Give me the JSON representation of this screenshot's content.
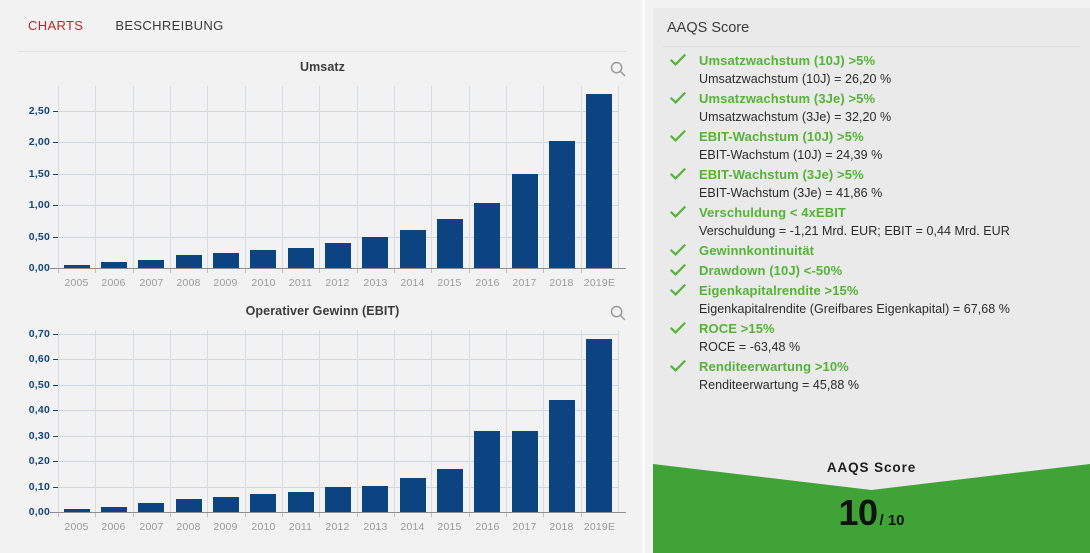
{
  "tabs": [
    {
      "label": "CHARTS",
      "active": true
    },
    {
      "label": "BESCHREIBUNG",
      "active": false
    }
  ],
  "colors": {
    "bar": "#0c4481",
    "accent_green": "#3fa335",
    "criteria_green": "#55b336",
    "tab_active": "#b5272d",
    "axis_label": "#14447c"
  },
  "icons": {
    "search": "search-icon",
    "check": "check-icon"
  },
  "chart_data": [
    {
      "type": "bar",
      "title": "Umsatz",
      "xlabel": "",
      "ylabel": "",
      "categories": [
        "2005",
        "2006",
        "2007",
        "2008",
        "2009",
        "2010",
        "2011",
        "2012",
        "2013",
        "2014",
        "2015",
        "2016",
        "2017",
        "2018",
        "2019E"
      ],
      "values": [
        0.05,
        0.09,
        0.13,
        0.2,
        0.24,
        0.28,
        0.32,
        0.4,
        0.5,
        0.6,
        0.78,
        1.03,
        1.5,
        2.03,
        2.78
      ],
      "yticks": [
        "0,00",
        "0,50",
        "1,00",
        "1,50",
        "2,00",
        "2,50"
      ],
      "ytick_values": [
        0,
        0.5,
        1.0,
        1.5,
        2.0,
        2.5
      ],
      "ylim": [
        0,
        2.9
      ],
      "grid": true,
      "legend": "none"
    },
    {
      "type": "bar",
      "title": "Operativer Gewinn (EBIT)",
      "xlabel": "",
      "ylabel": "",
      "categories": [
        "2005",
        "2006",
        "2007",
        "2008",
        "2009",
        "2010",
        "2011",
        "2012",
        "2013",
        "2014",
        "2015",
        "2016",
        "2017",
        "2018",
        "2019E"
      ],
      "values": [
        0.01,
        0.02,
        0.035,
        0.05,
        0.06,
        0.07,
        0.08,
        0.1,
        0.102,
        0.135,
        0.17,
        0.32,
        0.318,
        0.44,
        0.68
      ],
      "yticks": [
        "0,00",
        "0,10",
        "0,20",
        "0,30",
        "0,40",
        "0,50",
        "0,60",
        "0,70"
      ],
      "ytick_values": [
        0,
        0.1,
        0.2,
        0.3,
        0.4,
        0.5,
        0.6,
        0.7
      ],
      "ylim": [
        0,
        0.715
      ],
      "grid": true,
      "legend": "none"
    }
  ],
  "aaqs": {
    "card_title": "AAQS Score",
    "criteria": [
      {
        "title": "Umsatzwachstum (10J) >5%",
        "sub": "Umsatzwachstum (10J) = 26,20 %",
        "passed": true
      },
      {
        "title": "Umsatzwachstum (3Je) >5%",
        "sub": "Umsatzwachstum (3Je) = 32,20 %",
        "passed": true
      },
      {
        "title": "EBIT-Wachstum (10J) >5%",
        "sub": "EBIT-Wachstum (10J) = 24,39 %",
        "passed": true
      },
      {
        "title": "EBIT-Wachstum (3Je) >5%",
        "sub": "EBIT-Wachstum (3Je) = 41,86 %",
        "passed": true
      },
      {
        "title": "Verschuldung < 4xEBIT",
        "sub": "Verschuldung = -1,21 Mrd. EUR; EBIT = 0,44 Mrd. EUR",
        "passed": true
      },
      {
        "title": "Gewinnkontinuität",
        "sub": "",
        "passed": true
      },
      {
        "title": "Drawdown (10J) <-50%",
        "sub": "",
        "passed": true
      },
      {
        "title": "Eigenkapitalrendite >15%",
        "sub": "Eigenkapitalrendite (Greifbares Eigenkapital) = 67,68 %",
        "passed": true
      },
      {
        "title": "ROCE >15%",
        "sub": "ROCE = -63,48 %",
        "passed": true
      },
      {
        "title": "Renditeerwartung >10%",
        "sub": "Renditeerwartung = 45,88 %",
        "passed": true
      }
    ],
    "banner_label": "AAQS Score",
    "score_value": "10",
    "score_denominator": "/ 10"
  }
}
